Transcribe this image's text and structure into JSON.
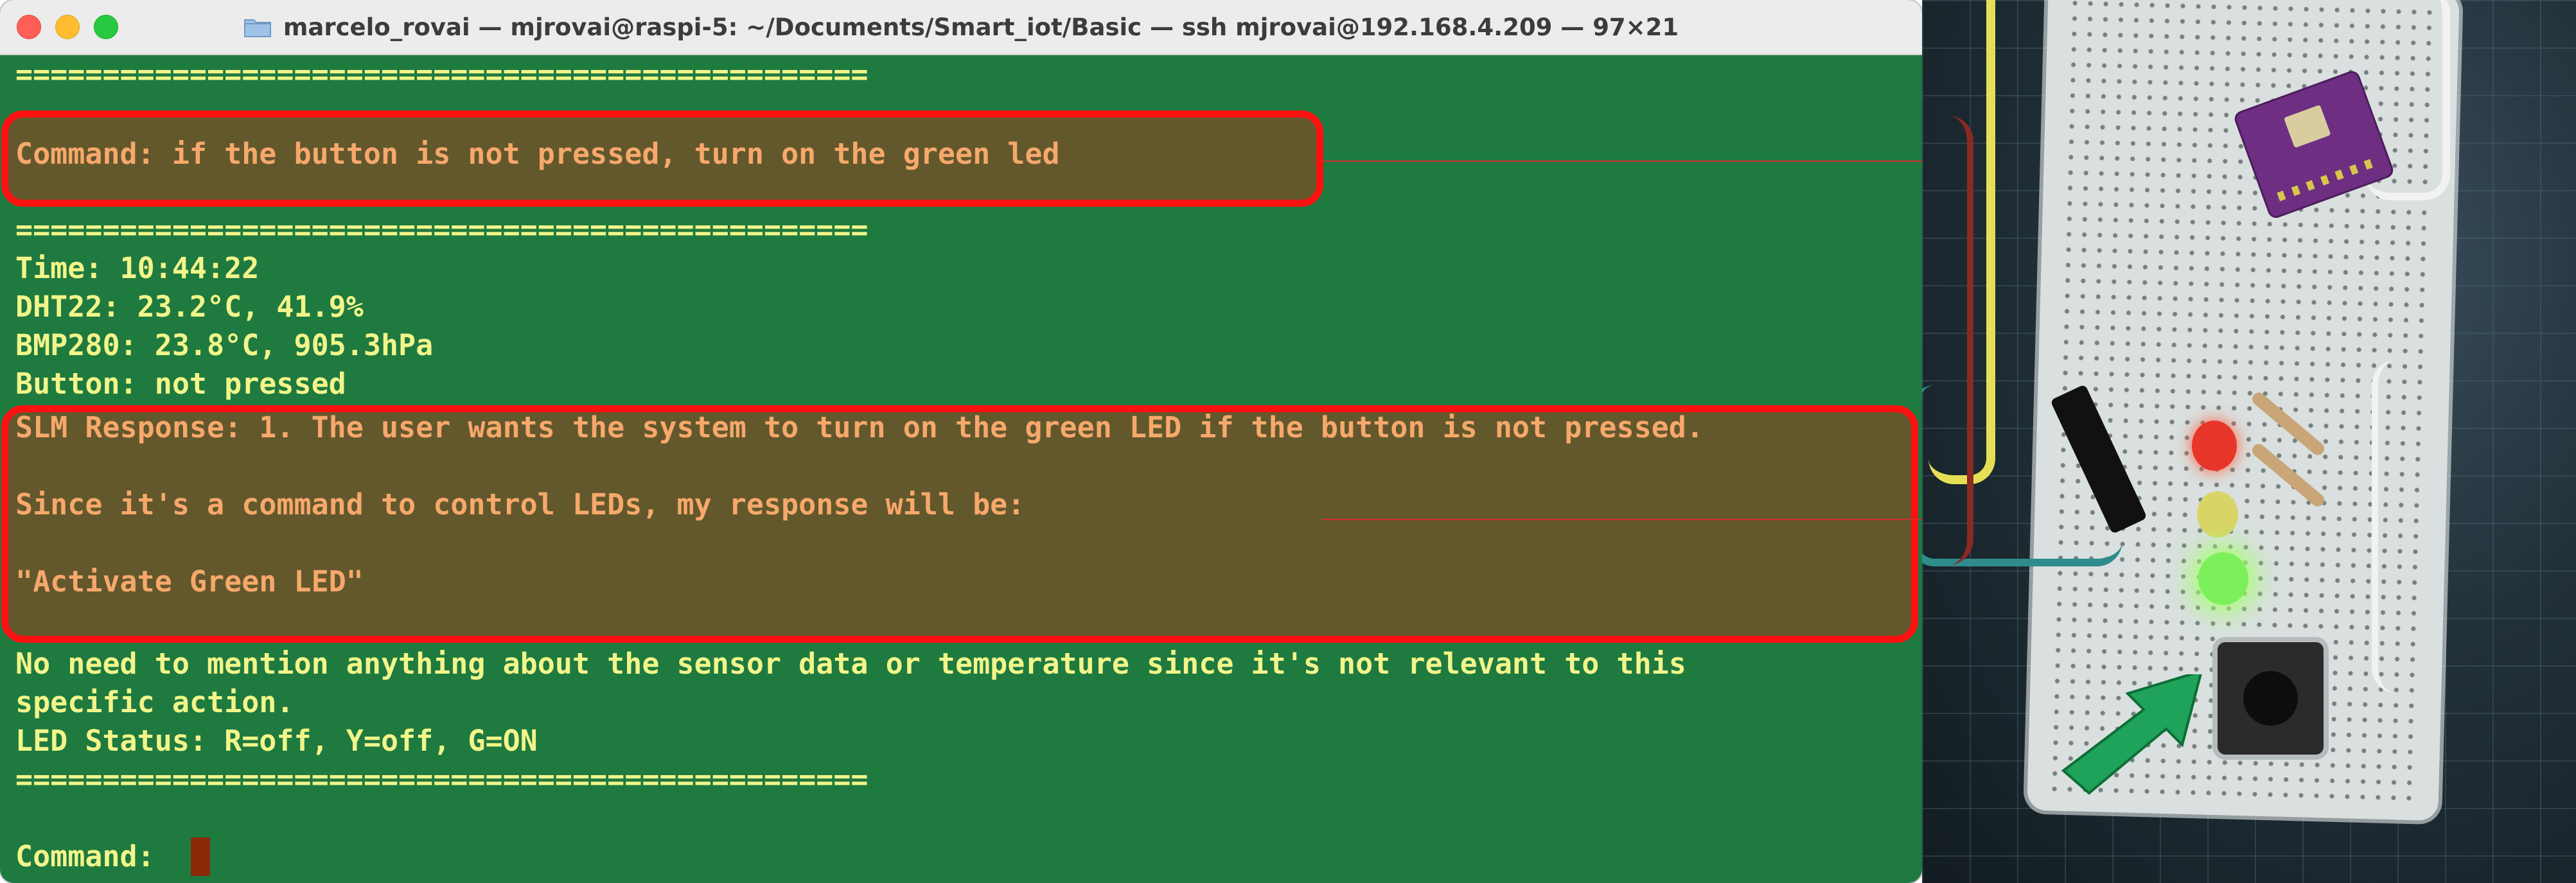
{
  "window": {
    "title": "marcelo_rovai — mjrovai@raspi-5: ~/Documents/Smart_iot/Basic — ssh mjrovai@192.168.4.209 — 97×21",
    "folder_icon": "folder-icon",
    "buttons": [
      "close",
      "minimize",
      "zoom"
    ]
  },
  "terminal": {
    "colors": {
      "background": "#1f7a3f",
      "text": "#f2f58a",
      "highlight_text": "#f7a86b",
      "highlight_border": "#ff1010"
    },
    "separator": "=================================================",
    "command_line": "Command: if the button is not pressed, turn on the green led",
    "time_line": "Time: 10:44:22",
    "dht_line": "DHT22: 23.2°C, 41.9%",
    "bmp_line": "BMP280: 23.8°C, 905.3hPa",
    "button_line": "Button: not pressed",
    "slm_line_1": "SLM Response: 1. The user wants the system to turn on the green LED if the button is not pressed.",
    "slm_line_2": "Since it's a command to control LEDs, my response will be:",
    "slm_line_3": "\"Activate Green LED\"",
    "note_line_1": "No need to mention anything about the sensor data or temperature since it's not relevant to this",
    "note_line_2": "specific action.",
    "led_status": "LED Status: R=off, Y=off, G=ON",
    "prompt": "Command: "
  },
  "photo": {
    "led_colors": {
      "red": "#e8352a",
      "yellow": "#d8d466",
      "green": "#7cf05a"
    },
    "arrow_color": "#1fa25a"
  }
}
